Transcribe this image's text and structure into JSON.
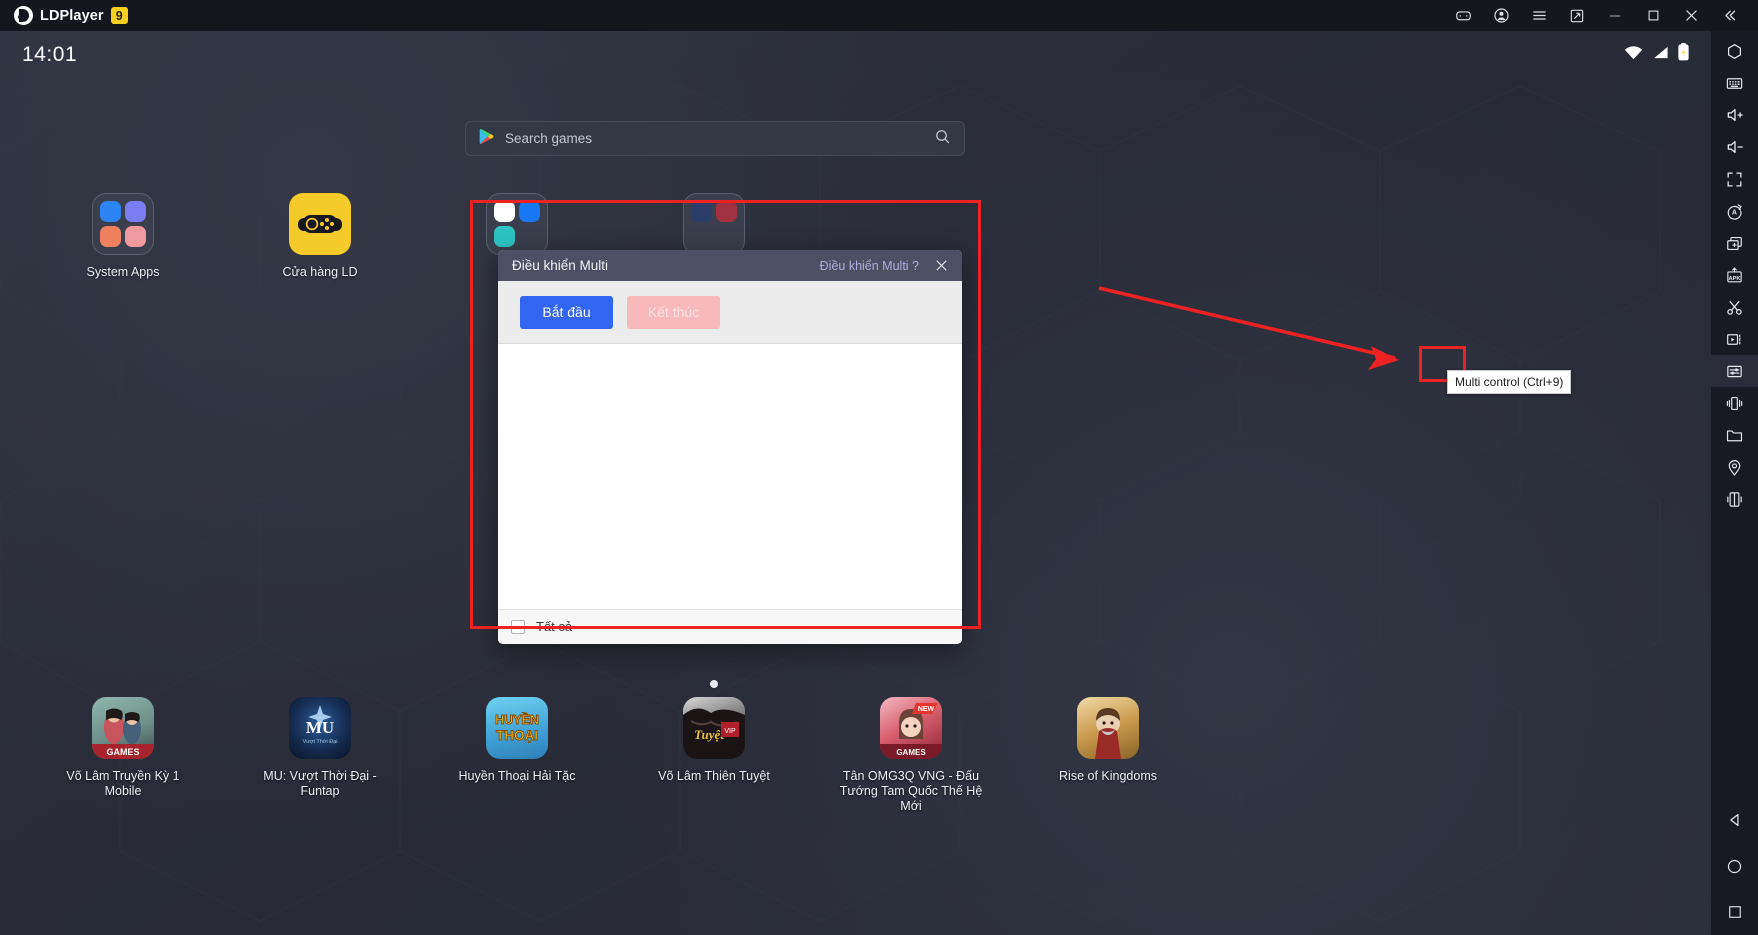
{
  "titlebar": {
    "brand": "LDPlayer",
    "version": "9",
    "buttons": [
      {
        "name": "gamepad-icon",
        "label": "Gamepad"
      },
      {
        "name": "account-icon",
        "label": "Account"
      },
      {
        "name": "menu-icon",
        "label": "Menu"
      },
      {
        "name": "resize-icon",
        "label": "Resize"
      },
      {
        "name": "minimize-icon",
        "label": "Minimize"
      },
      {
        "name": "maximize-icon",
        "label": "Maximize"
      },
      {
        "name": "close-icon",
        "label": "Close"
      },
      {
        "name": "collapse-icon",
        "label": "Collapse"
      }
    ]
  },
  "status": {
    "time": "14:01",
    "icons": [
      "wifi-icon",
      "signal-icon",
      "battery-icon"
    ]
  },
  "search": {
    "placeholder": "Search games",
    "play_icon": "google-play-icon",
    "submit_icon": "search-icon"
  },
  "desktop": {
    "row1": [
      {
        "label": "System Apps",
        "icon": "system-apps-folder-icon"
      },
      {
        "label": "Cửa hàng LD",
        "icon": "ld-store-icon"
      }
    ],
    "row2": [
      {
        "label": "Võ Lâm Truyền Kỳ 1 Mobile",
        "icon": "vltk1-icon"
      },
      {
        "label": "MU: Vượt Thời Đại - Funtap",
        "icon": "mu-icon"
      },
      {
        "label": "Huyền Thoại Hải Tặc",
        "icon": "htht-icon"
      },
      {
        "label": "Võ Lâm Thiên Tuyệt",
        "icon": "vltt-icon"
      },
      {
        "label": "Tân OMG3Q VNG - Đấu Tướng Tam Quốc Thế Hệ Mới",
        "icon": "omg3q-icon"
      },
      {
        "label": "Rise of Kingdoms",
        "icon": "rok-icon"
      }
    ],
    "hidden_row": [
      {
        "label": "",
        "icon": "chrome-icon"
      },
      {
        "label": "",
        "icon": "facebook-icon"
      }
    ]
  },
  "dialog": {
    "title": "Điều khiển Multi",
    "help_link": "Điều khiển Multi ?",
    "close_icon": "close-icon",
    "start_button": "Bắt đầu",
    "stop_button": "Kết thúc",
    "select_all_label": "Tất cả",
    "select_all_checked": false
  },
  "sidebar": {
    "items": [
      {
        "name": "sidebar-item-fullscreen-gyro",
        "icon": "hexagon-icon"
      },
      {
        "name": "sidebar-item-keyboard",
        "icon": "keyboard-icon"
      },
      {
        "name": "sidebar-item-volume-up",
        "icon": "volume-up-icon"
      },
      {
        "name": "sidebar-item-volume-down",
        "icon": "volume-down-icon"
      },
      {
        "name": "sidebar-item-fullscreen",
        "icon": "fullscreen-icon"
      },
      {
        "name": "sidebar-item-auto-rotate",
        "icon": "auto-rotate-icon"
      },
      {
        "name": "sidebar-item-new-instance",
        "icon": "add-instance-icon"
      },
      {
        "name": "sidebar-item-install-apk",
        "icon": "apk-install-icon"
      },
      {
        "name": "sidebar-item-screenshot",
        "icon": "scissors-icon"
      },
      {
        "name": "sidebar-item-record",
        "icon": "video-record-icon"
      },
      {
        "name": "sidebar-item-multi-control",
        "icon": "multi-control-icon"
      },
      {
        "name": "sidebar-item-shake",
        "icon": "shake-icon"
      },
      {
        "name": "sidebar-item-shared-folder",
        "icon": "folder-icon"
      },
      {
        "name": "sidebar-item-location",
        "icon": "location-icon"
      },
      {
        "name": "sidebar-item-virtual-device",
        "icon": "virtual-device-icon"
      }
    ],
    "nav": [
      {
        "name": "nav-back-button",
        "icon": "back-triangle-icon"
      },
      {
        "name": "nav-home-button",
        "icon": "home-circle-icon"
      },
      {
        "name": "nav-recents-button",
        "icon": "recents-square-icon"
      }
    ]
  },
  "tooltip": {
    "text": "Multi control (Ctrl+9)"
  },
  "colors": {
    "accent_blue": "#3366f0",
    "annotation_red": "#ee2222",
    "brand_yellow": "#f5d020",
    "dialog_header": "#4d5063",
    "help_link": "#a9aede"
  }
}
